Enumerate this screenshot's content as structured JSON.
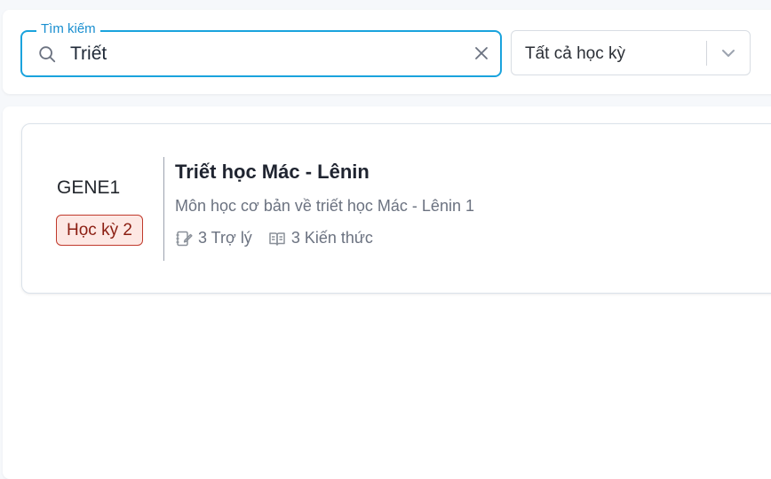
{
  "search": {
    "legend": "Tìm kiếm",
    "value": "Triết",
    "placeholder": ""
  },
  "semester_filter": {
    "selected": "Tất cả học kỳ"
  },
  "course": {
    "code": "GENE1",
    "semester_badge": "Học kỳ 2",
    "title": "Triết học Mác - Lênin",
    "description": "Môn học cơ bản về triết học Mác - Lênin 1",
    "assistants": "3 Trợ lý",
    "knowledge": "3 Kiến thức"
  },
  "icons": {
    "search": "search-icon",
    "clear": "close-icon",
    "dropdown": "chevron-down-icon",
    "assistant": "notebook-pen-icon",
    "knowledge": "open-book-icon"
  },
  "colors": {
    "accent": "#1aa3dd",
    "badge_border": "#c0392b",
    "badge_bg": "#fde8e4",
    "badge_text": "#8b1e12"
  }
}
